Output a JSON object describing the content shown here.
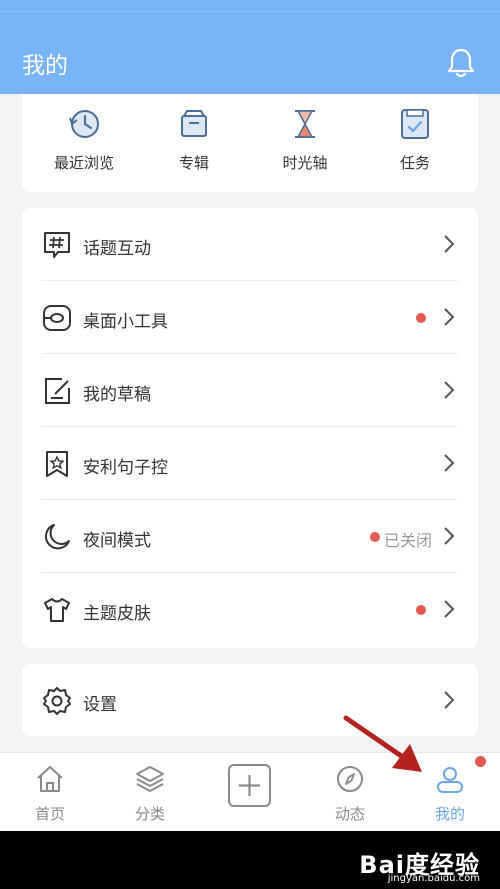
{
  "header": {
    "title": "我的",
    "bell_icon": "bell-icon",
    "bg_color": "#78b4f6"
  },
  "quick_actions": [
    {
      "label": "最近浏览",
      "icon": "history-clock-icon"
    },
    {
      "label": "专辑",
      "icon": "album-box-icon"
    },
    {
      "label": "时光轴",
      "icon": "hourglass-icon"
    },
    {
      "label": "任务",
      "icon": "task-checklist-icon"
    }
  ],
  "menu": [
    {
      "label": "话题互动",
      "icon": "hashtag-chat-icon",
      "dot": false,
      "status": ""
    },
    {
      "label": "桌面小工具",
      "icon": "widget-icon",
      "dot": true,
      "status": ""
    },
    {
      "label": "我的草稿",
      "icon": "draft-edit-icon",
      "dot": false,
      "status": ""
    },
    {
      "label": "安利句子控",
      "icon": "star-bookmark-icon",
      "dot": false,
      "status": ""
    },
    {
      "label": "夜间模式",
      "icon": "moon-icon",
      "dot": true,
      "status": "已关闭"
    },
    {
      "label": "主题皮肤",
      "icon": "shirt-icon",
      "dot": true,
      "status": ""
    }
  ],
  "settings": {
    "label": "设置",
    "icon": "gear-icon"
  },
  "tabs": [
    {
      "label": "首页",
      "icon": "home-icon",
      "active": false
    },
    {
      "label": "分类",
      "icon": "layers-icon",
      "active": false
    },
    {
      "label": "",
      "icon": "plus-icon",
      "active": false
    },
    {
      "label": "动态",
      "icon": "compass-icon",
      "active": false
    },
    {
      "label": "我的",
      "icon": "user-icon",
      "active": true
    }
  ],
  "watermark": {
    "text": "Bai度经验",
    "url": "jingyan.baidu.com"
  },
  "colors": {
    "accent": "#6aa8ee",
    "dot": "#e45a4e",
    "arrow": "#b3221c"
  }
}
